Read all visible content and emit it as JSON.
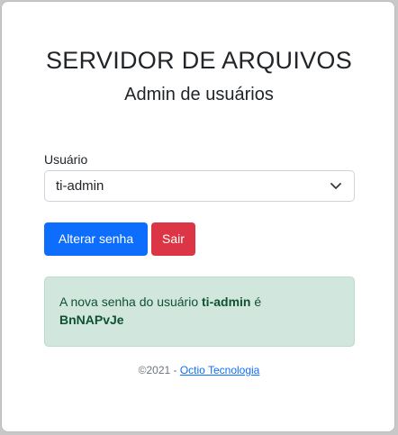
{
  "header": {
    "title": "SERVIDOR DE ARQUIVOS",
    "subtitle": "Admin de usuários"
  },
  "form": {
    "user_label": "Usuário",
    "user_select_value": "ti-admin",
    "change_password_label": "Alterar senha",
    "logout_label": "Sair"
  },
  "alert": {
    "prefix": "A nova senha do usuário ",
    "username": "ti-admin",
    "middle": " é",
    "password": "BnNAPvJe"
  },
  "footer": {
    "copyright": "©2021 - ",
    "link_text": "Octio Tecnologia"
  },
  "colors": {
    "primary": "#0d6efd",
    "danger": "#dc3545",
    "success_bg": "#d1e7dd",
    "success_text": "#0f5132"
  },
  "icons": {
    "select_arrow": "chevron-down-icon"
  }
}
